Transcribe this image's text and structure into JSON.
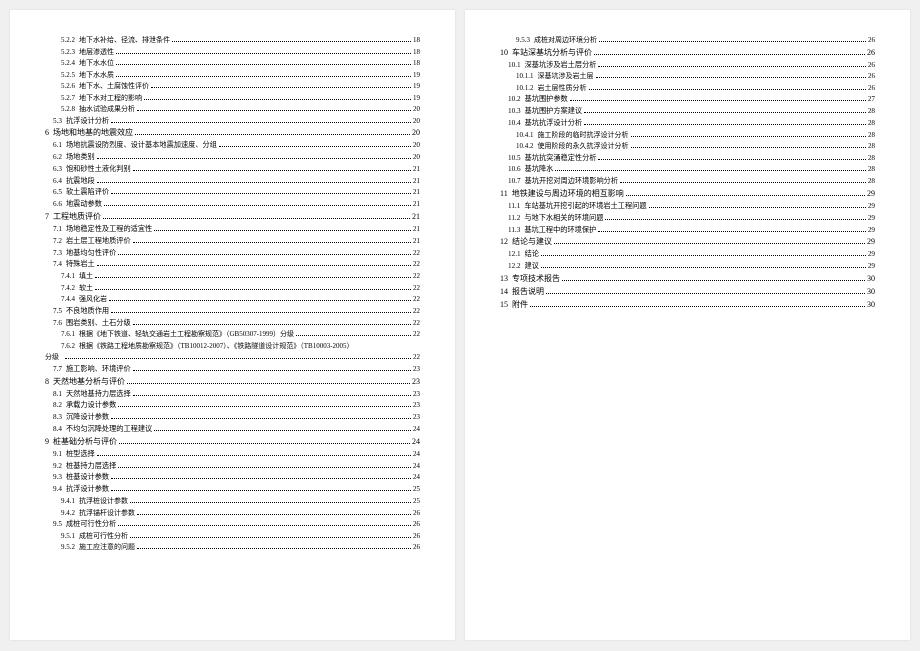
{
  "left": [
    {
      "lvl": 2,
      "num": "5.2.2",
      "title": "地下水补给、径流、排泄条件",
      "pg": "18"
    },
    {
      "lvl": 2,
      "num": "5.2.3",
      "title": "地层渗透性",
      "pg": "18"
    },
    {
      "lvl": 2,
      "num": "5.2.4",
      "title": "地下水水位",
      "pg": "18"
    },
    {
      "lvl": 2,
      "num": "5.2.5",
      "title": "地下水水质",
      "pg": "19"
    },
    {
      "lvl": 2,
      "num": "5.2.6",
      "title": "地下水、土腐蚀性评价",
      "pg": "19"
    },
    {
      "lvl": 2,
      "num": "5.2.7",
      "title": "地下水对工程的影响",
      "pg": "19"
    },
    {
      "lvl": 2,
      "num": "5.2.8",
      "title": "抽水试验成果分析",
      "pg": "20"
    },
    {
      "lvl": 1,
      "num": "5.3",
      "title": "抗浮设计分析",
      "pg": "20"
    },
    {
      "lvl": 0,
      "num": "6",
      "title": "场地和地基的地震效应",
      "pg": "20"
    },
    {
      "lvl": 1,
      "num": "6.1",
      "title": "场地抗震设防烈度、设计基本地震加速度、分组",
      "pg": "20"
    },
    {
      "lvl": 1,
      "num": "6.2",
      "title": "场地类别",
      "pg": "20"
    },
    {
      "lvl": 1,
      "num": "6.3",
      "title": "饱和砂性土液化判别",
      "pg": "21"
    },
    {
      "lvl": 1,
      "num": "6.4",
      "title": "抗震地段",
      "pg": "21"
    },
    {
      "lvl": 1,
      "num": "6.5",
      "title": "软土震陷评价",
      "pg": "21"
    },
    {
      "lvl": 1,
      "num": "6.6",
      "title": "地震动参数",
      "pg": "21"
    },
    {
      "lvl": 0,
      "num": "7",
      "title": "工程地质评价",
      "pg": "21"
    },
    {
      "lvl": 1,
      "num": "7.1",
      "title": "场地稳定性及工程的适宜性",
      "pg": "21"
    },
    {
      "lvl": 1,
      "num": "7.2",
      "title": "岩土层工程地质评价",
      "pg": "21"
    },
    {
      "lvl": 1,
      "num": "7.3",
      "title": "地基均匀性评价",
      "pg": "22"
    },
    {
      "lvl": 1,
      "num": "7.4",
      "title": "特殊岩土",
      "pg": "22"
    },
    {
      "lvl": 2,
      "num": "7.4.1",
      "title": "填土",
      "pg": "22"
    },
    {
      "lvl": 2,
      "num": "7.4.2",
      "title": "软土",
      "pg": "22"
    },
    {
      "lvl": 2,
      "num": "7.4.4",
      "title": "强风化岩",
      "pg": "22"
    },
    {
      "lvl": 1,
      "num": "7.5",
      "title": "不良地质作用",
      "pg": "22"
    },
    {
      "lvl": 1,
      "num": "7.6",
      "title": "围岩类别、土石分级",
      "pg": "22"
    },
    {
      "lvl": 2,
      "num": "7.6.1",
      "title": "根据《地下铁道、轻轨交通岩土工程勘察规范》（GB50307-1999）分级",
      "pg": "22"
    },
    {
      "lvl": 2,
      "num": "7.6.2",
      "title": "根据《铁路工程地质勘察规范》（TB10012-2007）、《铁路隧道设计规范》（TB10003-2005）",
      "pg": ""
    },
    {
      "lvl": 2,
      "num": "分级",
      "title": "",
      "pg": "22",
      "leftpad": true
    },
    {
      "lvl": 1,
      "num": "7.7",
      "title": "施工影响、环境评价",
      "pg": "23"
    },
    {
      "lvl": 0,
      "num": "8",
      "title": "天然地基分析与评价",
      "pg": "23"
    },
    {
      "lvl": 1,
      "num": "8.1",
      "title": "天然地基持力层选择",
      "pg": "23"
    },
    {
      "lvl": 1,
      "num": "8.2",
      "title": "承载力设计参数",
      "pg": "23"
    },
    {
      "lvl": 1,
      "num": "8.3",
      "title": "沉降设计参数",
      "pg": "23"
    },
    {
      "lvl": 1,
      "num": "8.4",
      "title": "不均匀沉降处理的工程建议",
      "pg": "24"
    },
    {
      "lvl": 0,
      "num": "9",
      "title": "桩基础分析与评价",
      "pg": "24"
    },
    {
      "lvl": 1,
      "num": "9.1",
      "title": "桩型选择",
      "pg": "24"
    },
    {
      "lvl": 1,
      "num": "9.2",
      "title": "桩基持力层选择",
      "pg": "24"
    },
    {
      "lvl": 1,
      "num": "9.3",
      "title": "桩基设计参数",
      "pg": "24"
    },
    {
      "lvl": 1,
      "num": "9.4",
      "title": "抗浮设计参数",
      "pg": "25"
    },
    {
      "lvl": 2,
      "num": "9.4.1",
      "title": "抗浮桩设计参数",
      "pg": "25"
    },
    {
      "lvl": 2,
      "num": "9.4.2",
      "title": "抗浮锚杆设计参数",
      "pg": "26"
    },
    {
      "lvl": 1,
      "num": "9.5",
      "title": "成桩可行性分析",
      "pg": "26"
    },
    {
      "lvl": 2,
      "num": "9.5.1",
      "title": "成桩可行性分析",
      "pg": "26"
    },
    {
      "lvl": 2,
      "num": "9.5.2",
      "title": "施工应注意的问题",
      "pg": "26"
    }
  ],
  "right": [
    {
      "lvl": 2,
      "num": "9.5.3",
      "title": "成桩对周边环境分析",
      "pg": "26"
    },
    {
      "lvl": 0,
      "num": "10",
      "title": "车站深基坑分析与评价",
      "pg": "26"
    },
    {
      "lvl": 1,
      "num": "10.1",
      "title": "深基坑涉及岩土层分析",
      "pg": "26"
    },
    {
      "lvl": 2,
      "num": "10.1.1",
      "title": "深基坑涉及岩土层",
      "pg": "26"
    },
    {
      "lvl": 2,
      "num": "10.1.2",
      "title": "岩土层性质分析",
      "pg": "26"
    },
    {
      "lvl": 1,
      "num": "10.2",
      "title": "基坑围护参数",
      "pg": "27"
    },
    {
      "lvl": 1,
      "num": "10.3",
      "title": "基坑围护方案建议",
      "pg": "28"
    },
    {
      "lvl": 1,
      "num": "10.4",
      "title": "基坑抗浮设计分析",
      "pg": "28"
    },
    {
      "lvl": 2,
      "num": "10.4.1",
      "title": "施工阶段的临时抗浮设计分析",
      "pg": "28"
    },
    {
      "lvl": 2,
      "num": "10.4.2",
      "title": "使用阶段的永久抗浮设计分析",
      "pg": "28"
    },
    {
      "lvl": 1,
      "num": "10.5",
      "title": "基坑抗突涌稳定性分析",
      "pg": "28"
    },
    {
      "lvl": 1,
      "num": "10.6",
      "title": "基坑降水",
      "pg": "28"
    },
    {
      "lvl": 1,
      "num": "10.7",
      "title": "基坑开挖对周边环境影响分析",
      "pg": "28"
    },
    {
      "lvl": 0,
      "num": "11",
      "title": "地铁建设与周边环境的相互影响",
      "pg": "29"
    },
    {
      "lvl": 1,
      "num": "11.1",
      "title": "车站基坑开挖引起的环境岩土工程问题",
      "pg": "29"
    },
    {
      "lvl": 1,
      "num": "11.2",
      "title": "与地下水相关的环境问题",
      "pg": "29"
    },
    {
      "lvl": 1,
      "num": "11.3",
      "title": "基坑工程中的环境保护",
      "pg": "29"
    },
    {
      "lvl": 0,
      "num": "12",
      "title": "结论与建议",
      "pg": "29"
    },
    {
      "lvl": 1,
      "num": "12.1",
      "title": "结论",
      "pg": "29"
    },
    {
      "lvl": 1,
      "num": "12.2",
      "title": "建议",
      "pg": "29"
    },
    {
      "lvl": 0,
      "num": "13",
      "title": "专项技术报告",
      "pg": "30"
    },
    {
      "lvl": 0,
      "num": "14",
      "title": "报告说明",
      "pg": "30"
    },
    {
      "lvl": 0,
      "num": "15",
      "title": "附件",
      "pg": "30"
    }
  ]
}
